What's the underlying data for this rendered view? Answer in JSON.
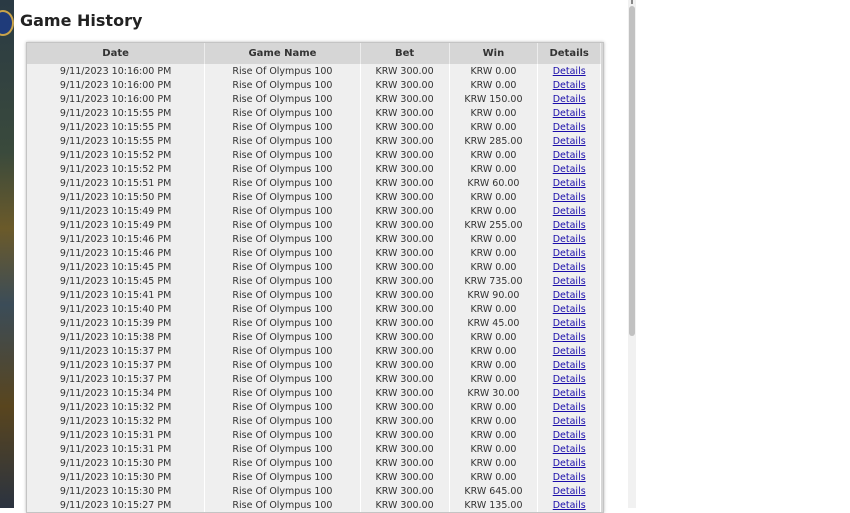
{
  "page": {
    "title": "Game History"
  },
  "table": {
    "headers": [
      "Date",
      "Game Name",
      "Bet",
      "Win",
      "Details"
    ],
    "rows": [
      [
        "9/11/2023 10:16:00 PM",
        "Rise Of Olympus 100",
        "KRW 300.00",
        "KRW 0.00",
        "Details"
      ],
      [
        "9/11/2023 10:16:00 PM",
        "Rise Of Olympus 100",
        "KRW 300.00",
        "KRW 0.00",
        "Details"
      ],
      [
        "9/11/2023 10:16:00 PM",
        "Rise Of Olympus 100",
        "KRW 300.00",
        "KRW 150.00",
        "Details"
      ],
      [
        "9/11/2023 10:15:55 PM",
        "Rise Of Olympus 100",
        "KRW 300.00",
        "KRW 0.00",
        "Details"
      ],
      [
        "9/11/2023 10:15:55 PM",
        "Rise Of Olympus 100",
        "KRW 300.00",
        "KRW 0.00",
        "Details"
      ],
      [
        "9/11/2023 10:15:55 PM",
        "Rise Of Olympus 100",
        "KRW 300.00",
        "KRW 285.00",
        "Details"
      ],
      [
        "9/11/2023 10:15:52 PM",
        "Rise Of Olympus 100",
        "KRW 300.00",
        "KRW 0.00",
        "Details"
      ],
      [
        "9/11/2023 10:15:52 PM",
        "Rise Of Olympus 100",
        "KRW 300.00",
        "KRW 0.00",
        "Details"
      ],
      [
        "9/11/2023 10:15:51 PM",
        "Rise Of Olympus 100",
        "KRW 300.00",
        "KRW 60.00",
        "Details"
      ],
      [
        "9/11/2023 10:15:50 PM",
        "Rise Of Olympus 100",
        "KRW 300.00",
        "KRW 0.00",
        "Details"
      ],
      [
        "9/11/2023 10:15:49 PM",
        "Rise Of Olympus 100",
        "KRW 300.00",
        "KRW 0.00",
        "Details"
      ],
      [
        "9/11/2023 10:15:49 PM",
        "Rise Of Olympus 100",
        "KRW 300.00",
        "KRW 255.00",
        "Details"
      ],
      [
        "9/11/2023 10:15:46 PM",
        "Rise Of Olympus 100",
        "KRW 300.00",
        "KRW 0.00",
        "Details"
      ],
      [
        "9/11/2023 10:15:46 PM",
        "Rise Of Olympus 100",
        "KRW 300.00",
        "KRW 0.00",
        "Details"
      ],
      [
        "9/11/2023 10:15:45 PM",
        "Rise Of Olympus 100",
        "KRW 300.00",
        "KRW 0.00",
        "Details"
      ],
      [
        "9/11/2023 10:15:45 PM",
        "Rise Of Olympus 100",
        "KRW 300.00",
        "KRW 735.00",
        "Details"
      ],
      [
        "9/11/2023 10:15:41 PM",
        "Rise Of Olympus 100",
        "KRW 300.00",
        "KRW 90.00",
        "Details"
      ],
      [
        "9/11/2023 10:15:40 PM",
        "Rise Of Olympus 100",
        "KRW 300.00",
        "KRW 0.00",
        "Details"
      ],
      [
        "9/11/2023 10:15:39 PM",
        "Rise Of Olympus 100",
        "KRW 300.00",
        "KRW 45.00",
        "Details"
      ],
      [
        "9/11/2023 10:15:38 PM",
        "Rise Of Olympus 100",
        "KRW 300.00",
        "KRW 0.00",
        "Details"
      ],
      [
        "9/11/2023 10:15:37 PM",
        "Rise Of Olympus 100",
        "KRW 300.00",
        "KRW 0.00",
        "Details"
      ],
      [
        "9/11/2023 10:15:37 PM",
        "Rise Of Olympus 100",
        "KRW 300.00",
        "KRW 0.00",
        "Details"
      ],
      [
        "9/11/2023 10:15:37 PM",
        "Rise Of Olympus 100",
        "KRW 300.00",
        "KRW 0.00",
        "Details"
      ],
      [
        "9/11/2023 10:15:34 PM",
        "Rise Of Olympus 100",
        "KRW 300.00",
        "KRW 30.00",
        "Details"
      ],
      [
        "9/11/2023 10:15:32 PM",
        "Rise Of Olympus 100",
        "KRW 300.00",
        "KRW 0.00",
        "Details"
      ],
      [
        "9/11/2023 10:15:32 PM",
        "Rise Of Olympus 100",
        "KRW 300.00",
        "KRW 0.00",
        "Details"
      ],
      [
        "9/11/2023 10:15:31 PM",
        "Rise Of Olympus 100",
        "KRW 300.00",
        "KRW 0.00",
        "Details"
      ],
      [
        "9/11/2023 10:15:31 PM",
        "Rise Of Olympus 100",
        "KRW 300.00",
        "KRW 0.00",
        "Details"
      ],
      [
        "9/11/2023 10:15:30 PM",
        "Rise Of Olympus 100",
        "KRW 300.00",
        "KRW 0.00",
        "Details"
      ],
      [
        "9/11/2023 10:15:30 PM",
        "Rise Of Olympus 100",
        "KRW 300.00",
        "KRW 0.00",
        "Details"
      ],
      [
        "9/11/2023 10:15:30 PM",
        "Rise Of Olympus 100",
        "KRW 300.00",
        "KRW 645.00",
        "Details"
      ],
      [
        "9/11/2023 10:15:27 PM",
        "Rise Of Olympus 100",
        "KRW 300.00",
        "KRW 135.00",
        "Details"
      ]
    ]
  },
  "colors": {
    "header_bg": "#d6d6d6",
    "row_bg": "#efefef",
    "link": "#1a0dab"
  }
}
